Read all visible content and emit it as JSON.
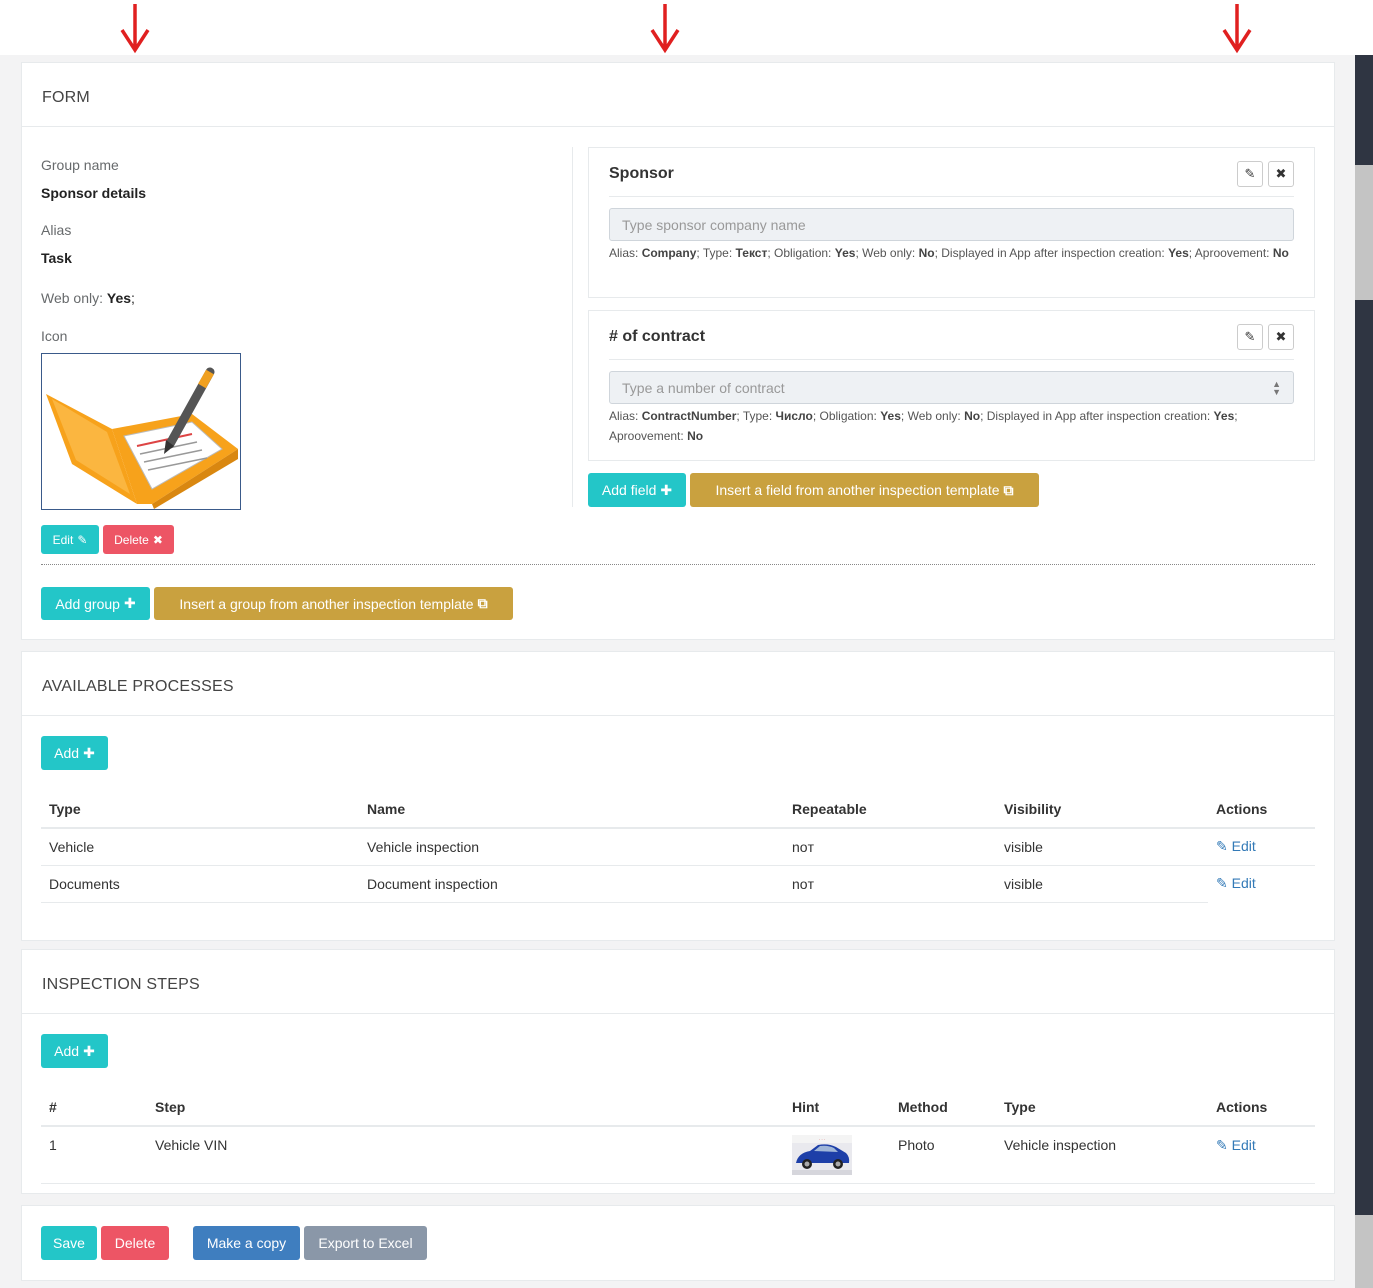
{
  "form": {
    "title": "FORM",
    "group_name_label": "Group name",
    "group_name_value": "Sponsor details",
    "alias_label": "Alias",
    "alias_value": "Task",
    "web_only_label": "Web only:",
    "web_only_value": "Yes",
    "icon_label": "Icon",
    "edit_label": "Edit",
    "delete_label": "Delete",
    "add_group_label": "Add group",
    "insert_group_label": "Insert a group from another inspection template",
    "fields": [
      {
        "title": "Sponsor",
        "placeholder": "Type sponsor company name",
        "meta_alias_label": "Alias:",
        "meta_alias": "Company",
        "meta_type_label": "Type:",
        "meta_type": "Текст",
        "meta_obligation_label": "Obligation:",
        "meta_obligation": "Yes",
        "meta_web_label": "Web only:",
        "meta_web": "No",
        "meta_displayed_label": "Displayed in App after inspection creation:",
        "meta_displayed": "Yes",
        "meta_approve_label": "Aproovement:",
        "meta_approve": "No"
      },
      {
        "title": "# of contract",
        "placeholder": "Type a number of contract",
        "meta_alias_label": "Alias:",
        "meta_alias": "ContractNumber",
        "meta_type_label": "Type:",
        "meta_type": "Число",
        "meta_obligation_label": "Obligation:",
        "meta_obligation": "Yes",
        "meta_web_label": "Web only:",
        "meta_web": "No",
        "meta_displayed_label": "Displayed in App after inspection creation:",
        "meta_displayed": "Yes",
        "meta_approve_label": "Aproovement:",
        "meta_approve": "No"
      }
    ],
    "add_field_label": "Add field",
    "insert_field_label": "Insert a field from another inspection template"
  },
  "processes": {
    "title": "AVAILABLE PROCESSES",
    "add_label": "Add",
    "columns": [
      "Type",
      "Name",
      "Repeatable",
      "Visibility",
      "Actions"
    ],
    "rows": [
      {
        "type": "Vehicle",
        "name": "Vehicle inspection",
        "repeatable": "noт",
        "visibility": "visible",
        "action": "Edit"
      },
      {
        "type": "Documents",
        "name": "Document inspection",
        "repeatable": "noт",
        "visibility": "visible",
        "action": "Edit"
      }
    ]
  },
  "steps": {
    "title": "INSPECTION STEPS",
    "add_label": "Add",
    "columns": [
      "#",
      "Step",
      "Hint",
      "Method",
      "Type",
      "Actions"
    ],
    "rows": [
      {
        "num": "1",
        "step": "Vehicle VIN",
        "method": "Photo",
        "type": "Vehicle inspection",
        "action": "Edit"
      }
    ]
  },
  "footer": {
    "save_label": "Save",
    "delete_label": "Delete",
    "copy_label": "Make a copy",
    "export_label": "Export to Excel"
  },
  "colors": {
    "info": "#23c6c8",
    "danger": "#ed5565",
    "warning": "#c9a13f",
    "primary": "#3f7ebf",
    "annotation_arrow": "#e02020"
  }
}
